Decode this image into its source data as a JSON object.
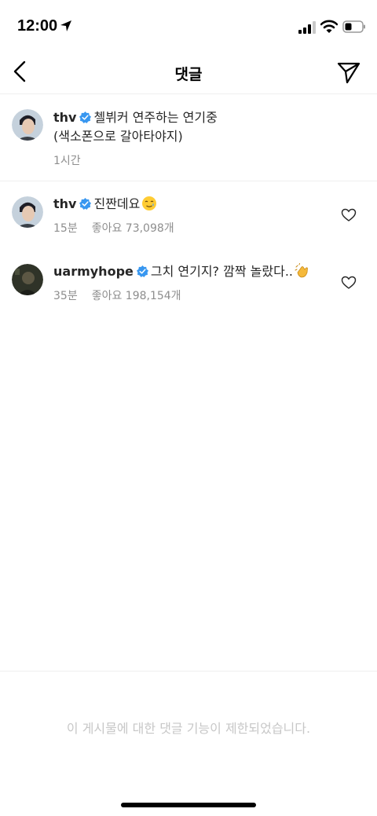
{
  "status_bar": {
    "time": "12:00"
  },
  "nav": {
    "title": "댓글"
  },
  "caption": {
    "username": "thv",
    "line1": "첼뷔커 연주하는 연기중",
    "line2": "(색소폰으로 갈아타야지)",
    "time": "1시간"
  },
  "comments": [
    {
      "username": "thv",
      "text": "진짠데요",
      "emoji": "crying-smile-emoji",
      "time": "15분",
      "likes": "좋아요 73,098개"
    },
    {
      "username": "uarmyhope",
      "text": "그치 연기지? 깜짝 놀랐다..",
      "emoji": "clapping-hands-emoji",
      "time": "35분",
      "likes": "좋아요 198,154개"
    }
  ],
  "footer": {
    "note": "이 게시물에 대한 댓글 기능이 제한되었습니다."
  },
  "colors": {
    "verified": "#3897f0",
    "meta": "#8e8e8e",
    "divider": "#efefef",
    "footer_text": "#c7c7c7"
  },
  "icons": [
    "location-arrow-icon",
    "signal-icon",
    "wifi-icon",
    "battery-icon",
    "back-icon",
    "send-icon",
    "verified-icon",
    "heart-icon"
  ]
}
